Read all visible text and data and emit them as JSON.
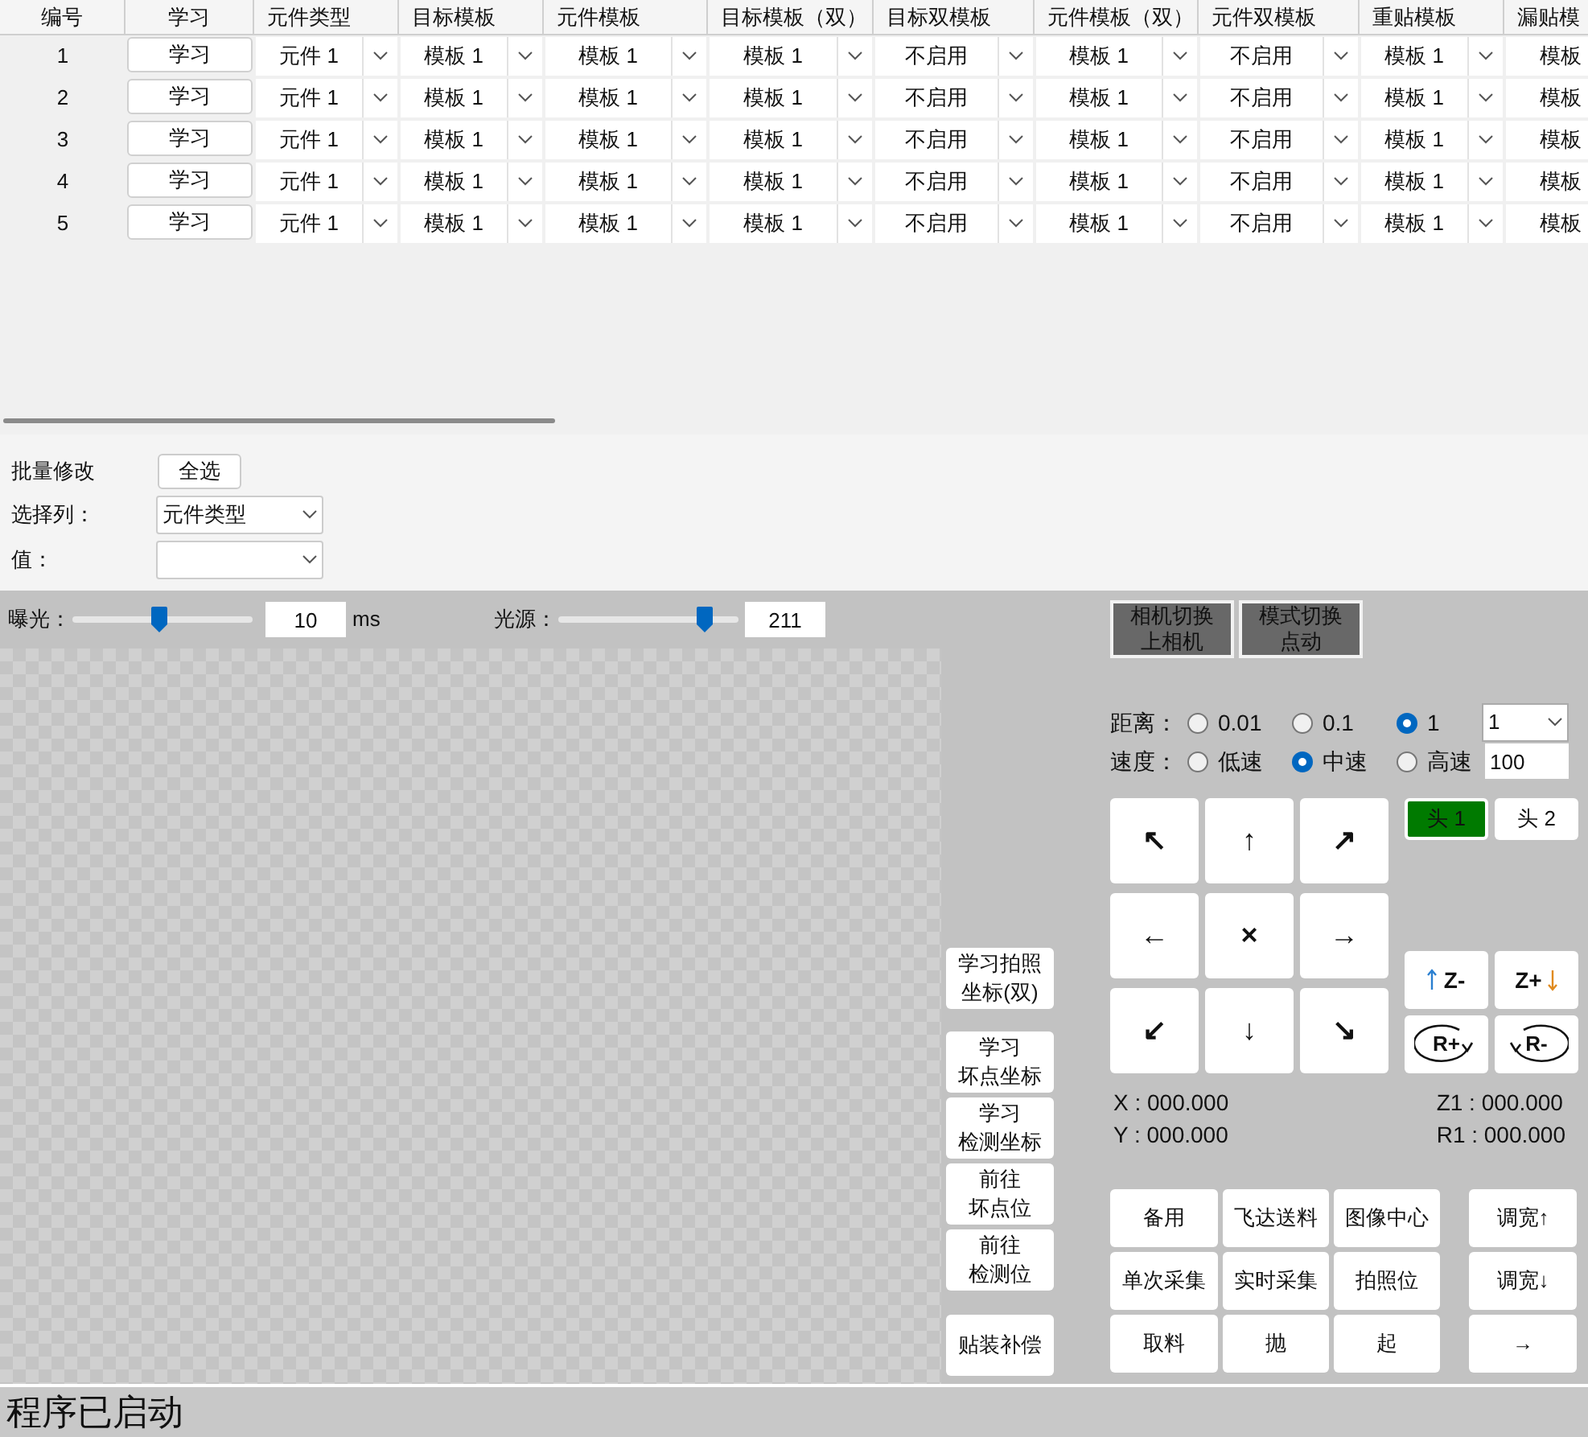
{
  "table": {
    "columns": [
      {
        "label": "编号",
        "kind": "index"
      },
      {
        "label": "学习",
        "kind": "button"
      },
      {
        "label": "元件类型",
        "kind": "combo"
      },
      {
        "label": "目标模板",
        "kind": "combo"
      },
      {
        "label": "元件模板",
        "kind": "combo"
      },
      {
        "label": "目标模板（双）",
        "kind": "combo"
      },
      {
        "label": "目标双模板",
        "kind": "combo"
      },
      {
        "label": "元件模板（双）",
        "kind": "combo"
      },
      {
        "label": "元件双模板",
        "kind": "combo"
      },
      {
        "label": "重贴模板",
        "kind": "combo"
      },
      {
        "label": "漏贴模",
        "kind": "combo"
      }
    ],
    "rows": [
      {
        "cells": [
          "1",
          "学习",
          "元件 1",
          "模板 1",
          "模板 1",
          "模板 1",
          "不启用",
          "模板 1",
          "不启用",
          "模板 1",
          "模板"
        ]
      },
      {
        "cells": [
          "2",
          "学习",
          "元件 1",
          "模板 1",
          "模板 1",
          "模板 1",
          "不启用",
          "模板 1",
          "不启用",
          "模板 1",
          "模板"
        ]
      },
      {
        "cells": [
          "3",
          "学习",
          "元件 1",
          "模板 1",
          "模板 1",
          "模板 1",
          "不启用",
          "模板 1",
          "不启用",
          "模板 1",
          "模板"
        ]
      },
      {
        "cells": [
          "4",
          "学习",
          "元件 1",
          "模板 1",
          "模板 1",
          "模板 1",
          "不启用",
          "模板 1",
          "不启用",
          "模板 1",
          "模板"
        ]
      },
      {
        "cells": [
          "5",
          "学习",
          "元件 1",
          "模板 1",
          "模板 1",
          "模板 1",
          "不启用",
          "模板 1",
          "不启用",
          "模板 1",
          "模板"
        ]
      }
    ]
  },
  "batch": {
    "title": "批量修改",
    "select_all": "全选",
    "column_label": "选择列：",
    "column_value": "元件类型",
    "value_label": "值："
  },
  "exposure": {
    "label": "曝光：",
    "level": 0.48,
    "value": "10",
    "unit": "ms"
  },
  "light": {
    "label": "光源：",
    "level": 0.81,
    "value": "211"
  },
  "side_buttons": [
    [
      "学习拍照",
      "坐标(双)"
    ],
    [
      "学习",
      "坏点坐标"
    ],
    [
      "学习",
      "检测坐标"
    ],
    [
      "前往",
      "坏点位"
    ],
    [
      "前往",
      "检测位"
    ],
    [
      "贴装补偿"
    ]
  ],
  "mode_buttons": [
    [
      "相机切换",
      "上相机"
    ],
    [
      "模式切换",
      "点动"
    ]
  ],
  "distance": {
    "label": "距离：",
    "options": [
      {
        "label": "0.01",
        "selected": false
      },
      {
        "label": "0.1",
        "selected": false
      },
      {
        "label": "1",
        "selected": true
      }
    ],
    "select": "1"
  },
  "speed": {
    "label": "速度：",
    "options": [
      {
        "label": "低速",
        "selected": false
      },
      {
        "label": "中速",
        "selected": true
      },
      {
        "label": "高速",
        "selected": false
      }
    ],
    "value": "100"
  },
  "jog_pad": [
    "↖",
    "↑",
    "↗",
    "←",
    "×",
    "→",
    "↙",
    "↓",
    "↘"
  ],
  "heads": [
    {
      "label": "头 1",
      "selected": true
    },
    {
      "label": "头 2",
      "selected": false
    }
  ],
  "z_buttons": [
    {
      "label": "Z-",
      "kind": "up"
    },
    {
      "label": "Z+",
      "kind": "down"
    }
  ],
  "r_buttons": [
    {
      "label": "R+",
      "kind": "cw"
    },
    {
      "label": "R-",
      "kind": "ccw"
    }
  ],
  "coords_left": [
    "X : 000.000",
    "Y : 000.000"
  ],
  "coords_right": [
    "Z1 : 000.000",
    "R1 : 000.000"
  ],
  "action_buttons": [
    [
      "备用",
      "飞达送料",
      "图像中心",
      "调宽↑"
    ],
    [
      "单次采集",
      "实时采集",
      "拍照位",
      "调宽↓"
    ],
    [
      "取料",
      "抛",
      "起",
      "→"
    ]
  ],
  "status": "程序已启动"
}
